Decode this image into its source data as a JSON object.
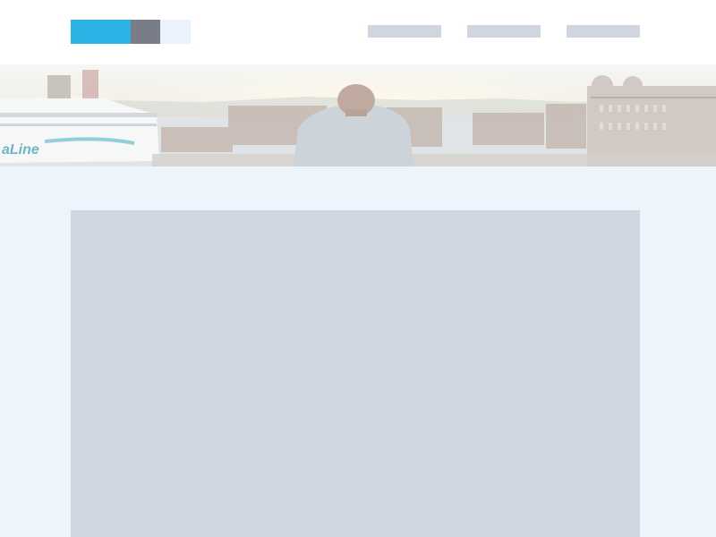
{
  "colors": {
    "page_background": "#eef4fc",
    "header_background": "#ffffff",
    "logo_primary": "#2bb3e6",
    "logo_secondary": "#787d88",
    "logo_tertiary": "#eaf3fd",
    "nav_placeholder": "#d0d6e0",
    "content_placeholder": "#d0d7e0"
  },
  "hero": {
    "ship_lettering": "aLine"
  }
}
